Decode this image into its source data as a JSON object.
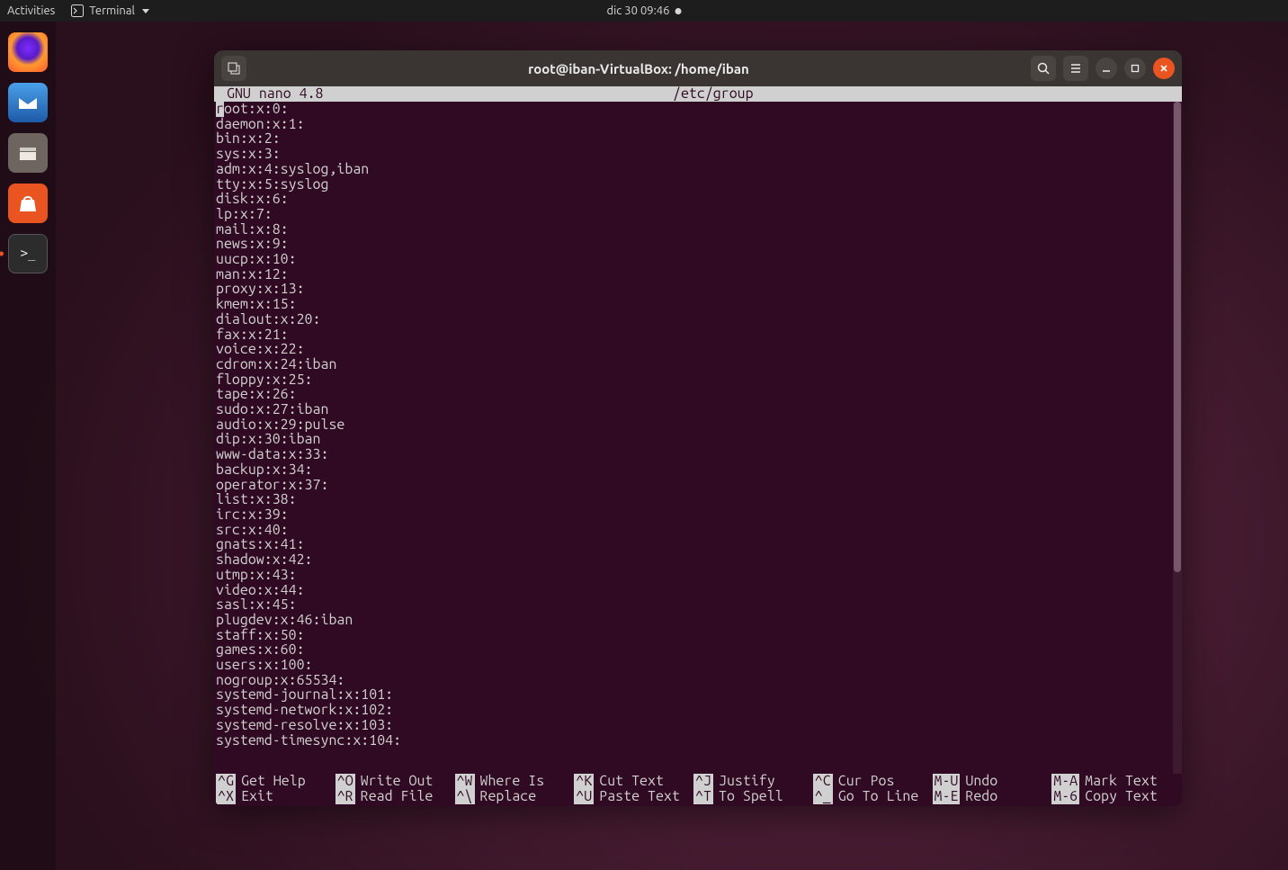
{
  "topbar": {
    "activities": "Activities",
    "app_name": "Terminal",
    "datetime": "dic 30  09:46"
  },
  "dock": {
    "items": [
      "firefox",
      "thunderbird",
      "files",
      "software",
      "terminal"
    ]
  },
  "window": {
    "title": "root@iban-VirtualBox: /home/iban"
  },
  "nano": {
    "version": "GNU nano 4.8",
    "filename": "/etc/group",
    "cursor_char": "r",
    "first_line_rest": "oot:x:0:",
    "lines": [
      "daemon:x:1:",
      "bin:x:2:",
      "sys:x:3:",
      "adm:x:4:syslog,iban",
      "tty:x:5:syslog",
      "disk:x:6:",
      "lp:x:7:",
      "mail:x:8:",
      "news:x:9:",
      "uucp:x:10:",
      "man:x:12:",
      "proxy:x:13:",
      "kmem:x:15:",
      "dialout:x:20:",
      "fax:x:21:",
      "voice:x:22:",
      "cdrom:x:24:iban",
      "floppy:x:25:",
      "tape:x:26:",
      "sudo:x:27:iban",
      "audio:x:29:pulse",
      "dip:x:30:iban",
      "www-data:x:33:",
      "backup:x:34:",
      "operator:x:37:",
      "list:x:38:",
      "irc:x:39:",
      "src:x:40:",
      "gnats:x:41:",
      "shadow:x:42:",
      "utmp:x:43:",
      "video:x:44:",
      "sasl:x:45:",
      "plugdev:x:46:iban",
      "staff:x:50:",
      "games:x:60:",
      "users:x:100:",
      "nogroup:x:65534:",
      "systemd-journal:x:101:",
      "systemd-network:x:102:",
      "systemd-resolve:x:103:",
      "systemd-timesync:x:104:"
    ],
    "shortcuts_row1": [
      {
        "key": "^G",
        "label": "Get Help"
      },
      {
        "key": "^O",
        "label": "Write Out"
      },
      {
        "key": "^W",
        "label": "Where Is"
      },
      {
        "key": "^K",
        "label": "Cut Text"
      },
      {
        "key": "^J",
        "label": "Justify"
      },
      {
        "key": "^C",
        "label": "Cur Pos"
      },
      {
        "key": "M-U",
        "label": "Undo"
      },
      {
        "key": "M-A",
        "label": "Mark Text"
      }
    ],
    "shortcuts_row2": [
      {
        "key": "^X",
        "label": "Exit"
      },
      {
        "key": "^R",
        "label": "Read File"
      },
      {
        "key": "^\\",
        "label": "Replace"
      },
      {
        "key": "^U",
        "label": "Paste Text"
      },
      {
        "key": "^T",
        "label": "To Spell"
      },
      {
        "key": "^_",
        "label": "Go To Line"
      },
      {
        "key": "M-E",
        "label": "Redo"
      },
      {
        "key": "M-6",
        "label": "Copy Text"
      }
    ]
  }
}
